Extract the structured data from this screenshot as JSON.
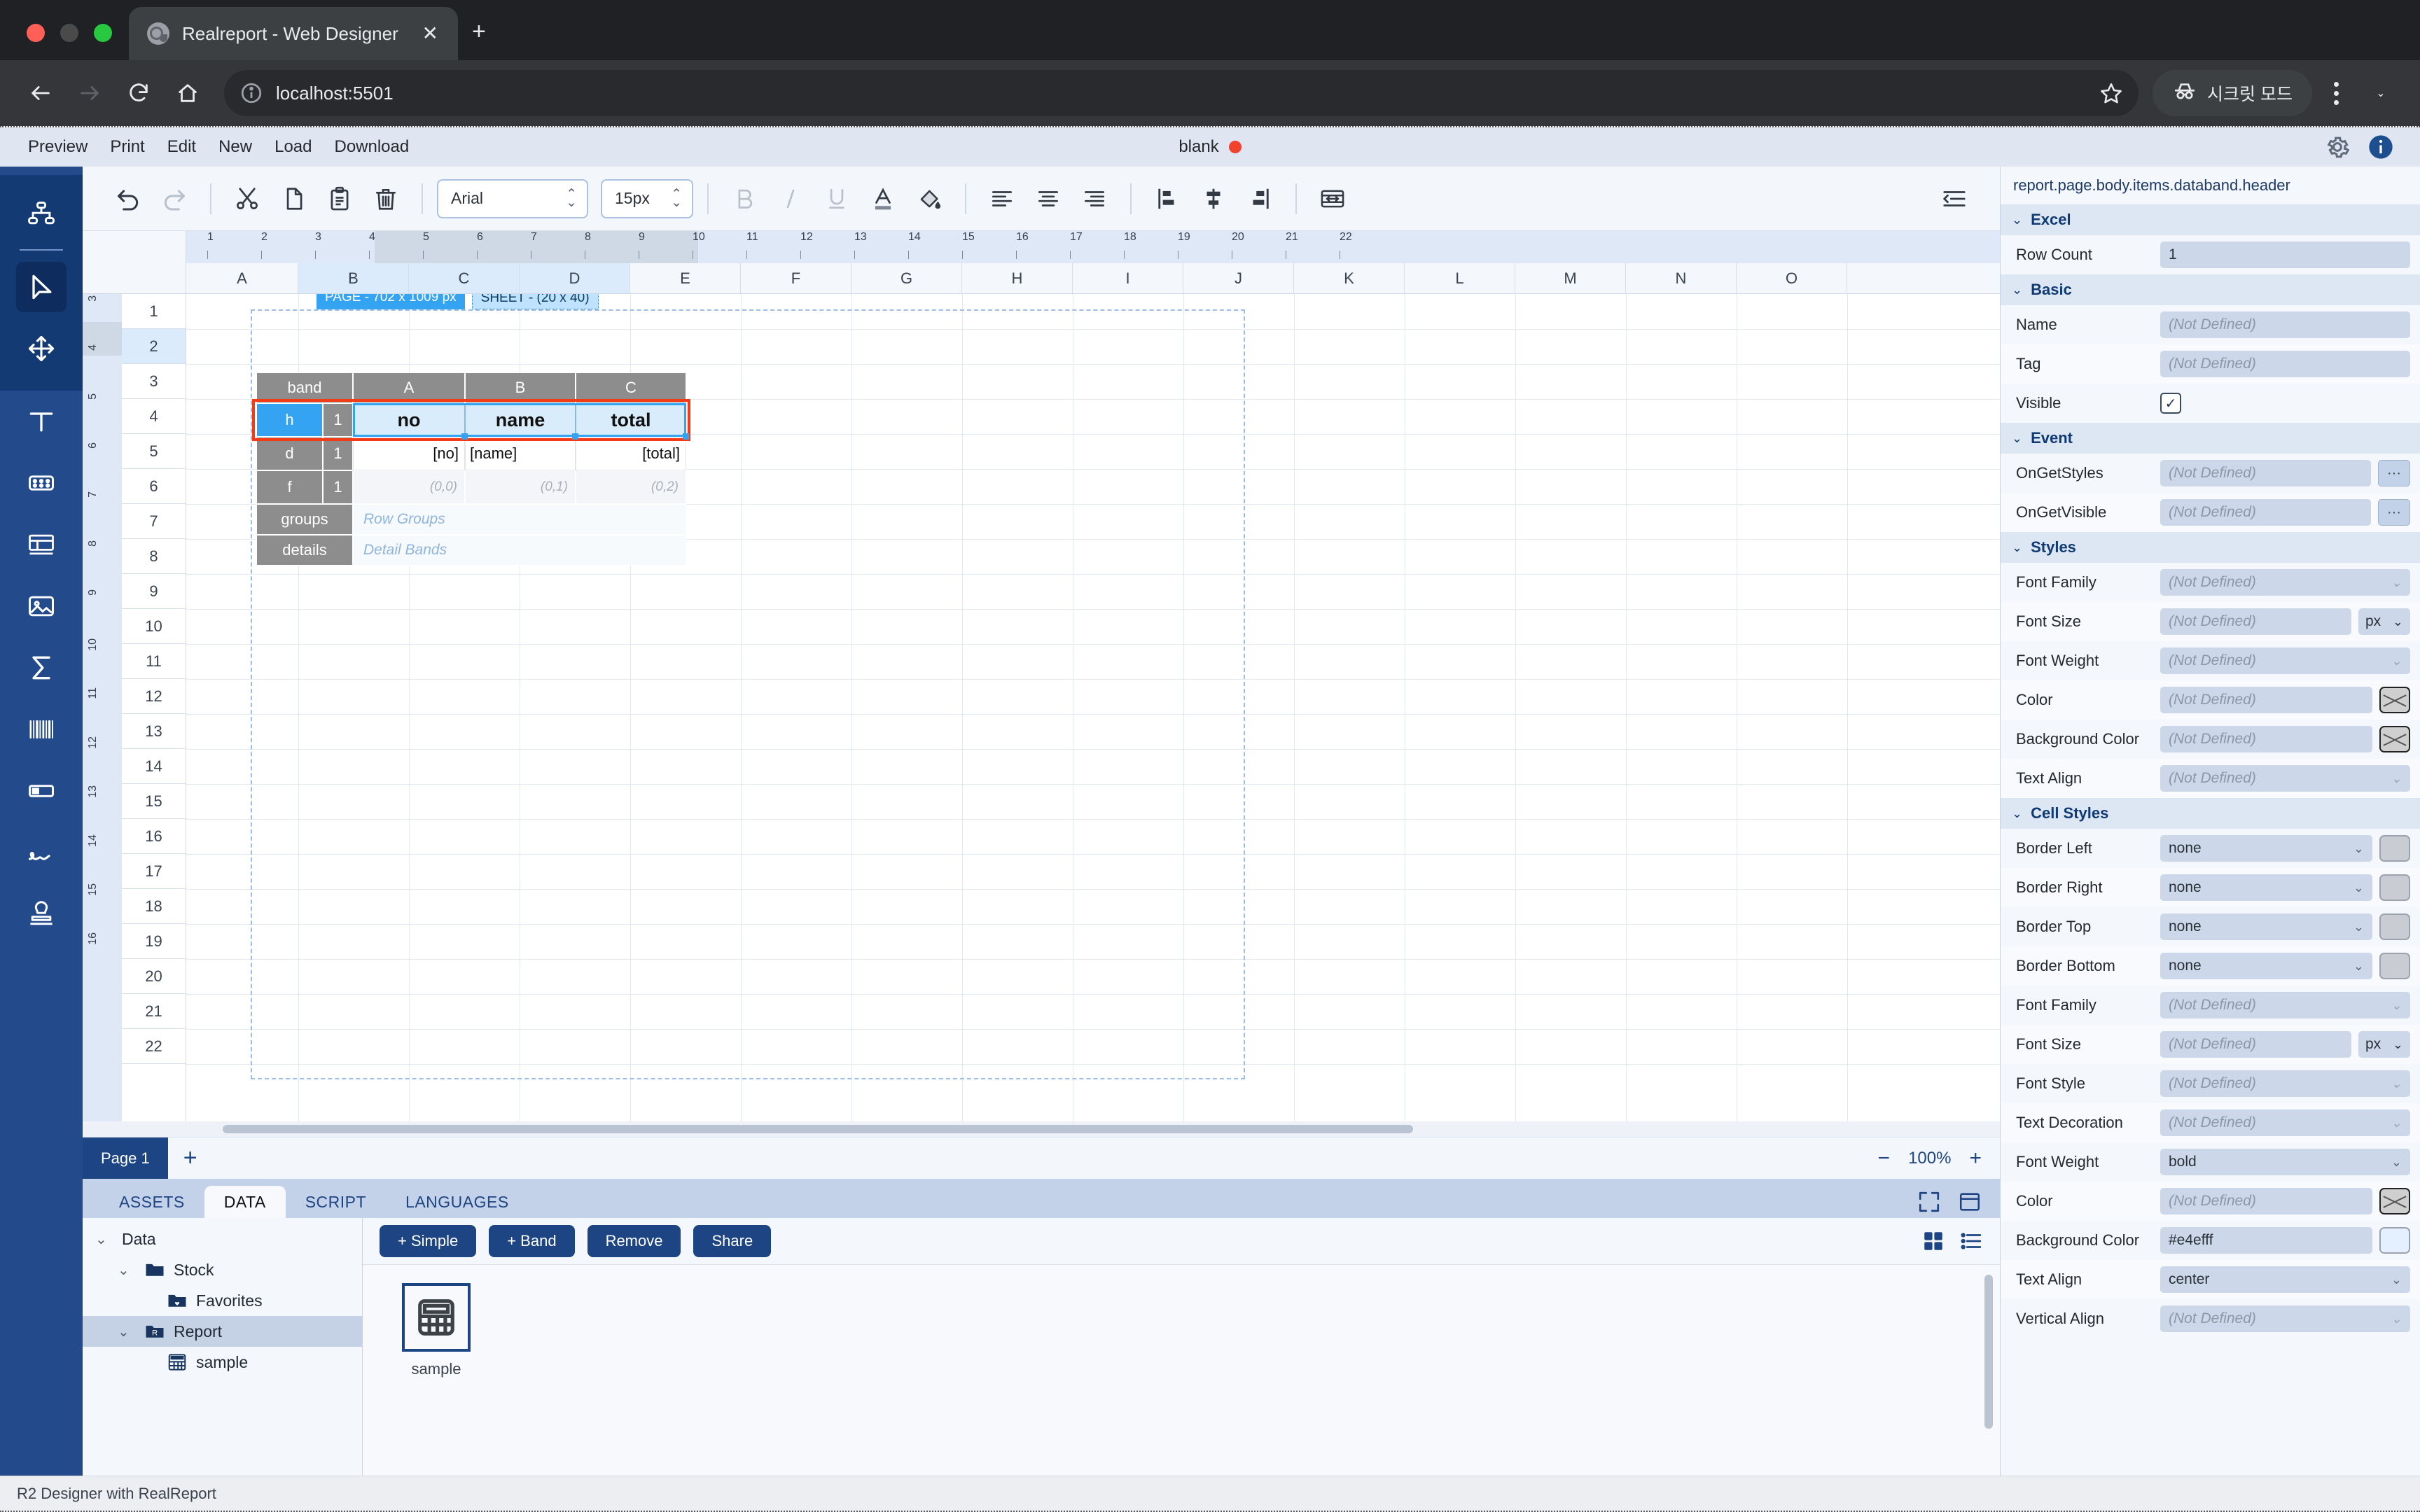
{
  "browser": {
    "tab_title": "Realreport - Web Designer",
    "tab_close_label": "✕",
    "new_tab_label": "+",
    "url": "localhost:5501",
    "incognito_label": "시크릿 모드",
    "window_caret": "⌄"
  },
  "app": {
    "menu": [
      "Preview",
      "Print",
      "Edit",
      "New",
      "Load",
      "Download"
    ],
    "doc_title": "blank",
    "status": "R2 Designer with RealReport"
  },
  "ribbon": {
    "font_family": "Arial",
    "font_size": "15px",
    "icons": [
      "undo",
      "redo",
      "cut",
      "copy",
      "paste",
      "delete",
      "bold",
      "italic",
      "underline",
      "font-color",
      "fill-color",
      "align-left",
      "align-center",
      "align-right",
      "valign-top",
      "valign-middle",
      "valign-bottom",
      "fit-width",
      "panel-toggle"
    ]
  },
  "sheet": {
    "columns": [
      "A",
      "B",
      "C",
      "D",
      "E",
      "F",
      "G",
      "H",
      "I",
      "J",
      "K",
      "L",
      "M",
      "N",
      "O"
    ],
    "selected_columns": [
      "B",
      "C",
      "D"
    ],
    "rows": [
      "1",
      "2",
      "3",
      "4",
      "5",
      "6",
      "7",
      "8",
      "9",
      "10",
      "11",
      "12",
      "13",
      "14",
      "15",
      "16",
      "17",
      "18",
      "19",
      "20",
      "21",
      "22"
    ],
    "selected_row": "2",
    "ruler_ticks": [
      "1",
      "2",
      "3",
      "4",
      "5",
      "6",
      "7",
      "8",
      "9",
      "10",
      "11",
      "12",
      "13",
      "14",
      "15",
      "16",
      "17",
      "18",
      "19",
      "20",
      "21",
      "22"
    ],
    "vruler_ticks": [
      "3",
      "4",
      "5",
      "6",
      "7",
      "8",
      "9",
      "10",
      "11",
      "12",
      "13",
      "14",
      "15",
      "16"
    ],
    "page_badge": "PAGE - 702 x 1009 px",
    "sheet_badge": "SHEET - (20 x 40)",
    "zoom": "100%",
    "zoom_out": "−",
    "zoom_in": "+",
    "page_tab": "Page 1",
    "add_page": "+"
  },
  "band_table": {
    "col_header_label": "band",
    "col_headers": [
      "A",
      "B",
      "C"
    ],
    "rows": [
      {
        "band": "h",
        "count": "1",
        "cells": [
          "no",
          "name",
          "total"
        ],
        "kind": "head"
      },
      {
        "band": "d",
        "count": "1",
        "cells": [
          "[no]",
          "[name]",
          "[total]"
        ],
        "kind": "data"
      },
      {
        "band": "f",
        "count": "1",
        "cells": [
          "(0,0)",
          "(0,1)",
          "(0,2)"
        ],
        "kind": "foot"
      }
    ],
    "groups_label": "groups",
    "groups_placeholder": "Row Groups",
    "details_label": "details",
    "details_placeholder": "Detail Bands"
  },
  "dock": {
    "tabs": [
      "ASSETS",
      "DATA",
      "SCRIPT",
      "LANGUAGES"
    ],
    "active_tab": "DATA",
    "tree": [
      {
        "label": "Data",
        "caret": "⌄",
        "icon": "none",
        "depth": 0,
        "selected": false
      },
      {
        "label": "Stock",
        "caret": "⌄",
        "icon": "folder",
        "depth": 1,
        "selected": false
      },
      {
        "label": "Favorites",
        "caret": "",
        "icon": "folder-heart",
        "depth": 2,
        "selected": false
      },
      {
        "label": "Report",
        "caret": "⌄",
        "icon": "folder-r",
        "depth": 1,
        "selected": true
      },
      {
        "label": "sample",
        "caret": "",
        "icon": "table",
        "depth": 2,
        "selected": false
      }
    ],
    "buttons": [
      "+ Simple",
      "+ Band",
      "Remove",
      "Share"
    ],
    "items": [
      {
        "label": "sample",
        "icon": "table-icon"
      }
    ]
  },
  "props": {
    "path": "report.page.body.items.databand.header",
    "placeholder": "(Not Defined)",
    "groups": [
      {
        "title": "Excel",
        "caret": "⌄",
        "rows": [
          {
            "label": "Row Count",
            "type": "text",
            "value": "1"
          }
        ]
      },
      {
        "title": "Basic",
        "caret": "⌄",
        "rows": [
          {
            "label": "Name",
            "type": "text",
            "value": "",
            "placeholder": "(Not Defined)"
          },
          {
            "label": "Tag",
            "type": "text",
            "value": "",
            "placeholder": "(Not Defined)"
          },
          {
            "label": "Visible",
            "type": "checkbox",
            "value": "✓"
          }
        ]
      },
      {
        "title": "Event",
        "caret": "⌄",
        "rows": [
          {
            "label": "OnGetStyles",
            "type": "text-ellipsis",
            "value": "",
            "placeholder": "(Not Defined)",
            "ellipsis": "···"
          },
          {
            "label": "OnGetVisible",
            "type": "text-ellipsis",
            "value": "",
            "placeholder": "(Not Defined)",
            "ellipsis": "···"
          }
        ]
      },
      {
        "title": "Styles",
        "caret": "⌄",
        "rows": [
          {
            "label": "Font Family",
            "type": "select",
            "value": "",
            "placeholder": "(Not Defined)"
          },
          {
            "label": "Font Size",
            "type": "text-unit",
            "value": "",
            "placeholder": "(Not Defined)",
            "unit": "px"
          },
          {
            "label": "Font Weight",
            "type": "select",
            "value": "",
            "placeholder": "(Not Defined)"
          },
          {
            "label": "Color",
            "type": "text-swatch-x",
            "value": "",
            "placeholder": "(Not Defined)"
          },
          {
            "label": "Background Color",
            "type": "text-swatch-x",
            "value": "",
            "placeholder": "(Not Defined)"
          },
          {
            "label": "Text Align",
            "type": "select",
            "value": "",
            "placeholder": "(Not Defined)"
          }
        ]
      },
      {
        "title": "Cell Styles",
        "caret": "⌄",
        "rows": [
          {
            "label": "Border Left",
            "type": "select-swatch",
            "value": "none",
            "swatch": "#c9cdd3"
          },
          {
            "label": "Border Right",
            "type": "select-swatch",
            "value": "none",
            "swatch": "#c9cdd3"
          },
          {
            "label": "Border Top",
            "type": "select-swatch",
            "value": "none",
            "swatch": "#c9cdd3"
          },
          {
            "label": "Border Bottom",
            "type": "select-swatch",
            "value": "none",
            "swatch": "#c9cdd3"
          },
          {
            "label": "Font Family",
            "type": "select",
            "value": "",
            "placeholder": "(Not Defined)"
          },
          {
            "label": "Font Size",
            "type": "text-unit",
            "value": "",
            "placeholder": "(Not Defined)",
            "unit": "px"
          },
          {
            "label": "Font Style",
            "type": "select",
            "value": "",
            "placeholder": "(Not Defined)"
          },
          {
            "label": "Text Decoration",
            "type": "select",
            "value": "",
            "placeholder": "(Not Defined)"
          },
          {
            "label": "Font Weight",
            "type": "select",
            "value": "bold"
          },
          {
            "label": "Color",
            "type": "text-swatch-x",
            "value": "",
            "placeholder": "(Not Defined)"
          },
          {
            "label": "Background Color",
            "type": "text-swatch",
            "value": "#e4efff",
            "swatch": "#e4efff"
          },
          {
            "label": "Text Align",
            "type": "select",
            "value": "center"
          },
          {
            "label": "Vertical Align",
            "type": "select",
            "value": "",
            "placeholder": "(Not Defined)"
          }
        ]
      }
    ]
  },
  "colors": {
    "brand": "#1e4583",
    "rail": "#234b8c",
    "rail_top": "#143a74",
    "accent_blue": "#34a3f2",
    "selection_red": "#f53b16",
    "header_bg": "#e4efff"
  }
}
